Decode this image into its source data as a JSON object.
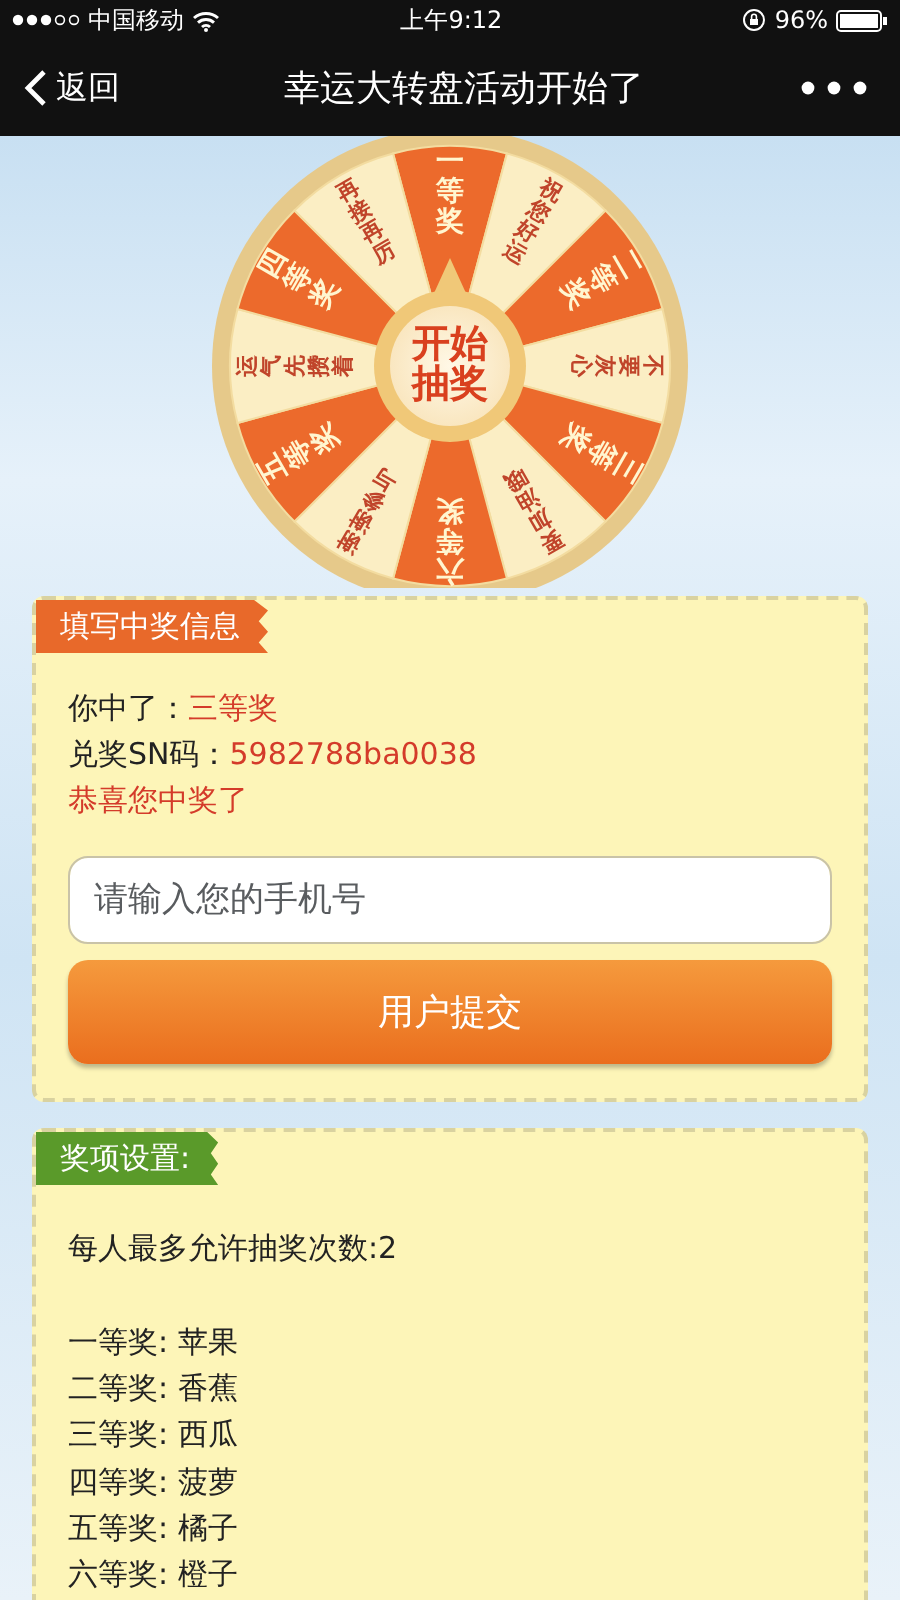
{
  "status_bar": {
    "carrier": "中国移动",
    "time": "上午9:12",
    "battery": "96%"
  },
  "nav": {
    "back": "返回",
    "title": "幸运大转盘活动开始了"
  },
  "wheel": {
    "segments": [
      {
        "label": "一等奖",
        "kind": "prize"
      },
      {
        "label": "祝您好运",
        "kind": "blank"
      },
      {
        "label": "二等奖",
        "kind": "prize"
      },
      {
        "label": "不要灰心",
        "kind": "blank"
      },
      {
        "label": "三等奖",
        "kind": "prize"
      },
      {
        "label": "要加油哦",
        "kind": "blank"
      },
      {
        "label": "六等奖",
        "kind": "prize"
      },
      {
        "label": "谢谢参与",
        "kind": "blank"
      },
      {
        "label": "五等奖",
        "kind": "prize"
      },
      {
        "label": "运气先攒着",
        "kind": "blank"
      },
      {
        "label": "四等奖",
        "kind": "prize"
      },
      {
        "label": "再接再厉",
        "kind": "blank"
      }
    ],
    "start_button": "开始抽奖"
  },
  "win_info": {
    "tag": "填写中奖信息",
    "rows": [
      {
        "label": "你中了：",
        "value": "三等奖"
      },
      {
        "label": "兑奖SN码：",
        "value": "5982788ba0038"
      }
    ],
    "message": "恭喜您中奖了",
    "phone": {
      "placeholder": "请输入您的手机号"
    },
    "submit": "用户提交"
  },
  "prize_settings": {
    "tag": "奖项设置:",
    "limit": "每人最多允许抽奖次数:2",
    "prizes": [
      "一等奖: 苹果",
      "二等奖: 香蕉",
      "三等奖: 西瓜",
      "四等奖: 菠萝",
      "五等奖: 橘子",
      "六等奖: 橙子"
    ]
  }
}
